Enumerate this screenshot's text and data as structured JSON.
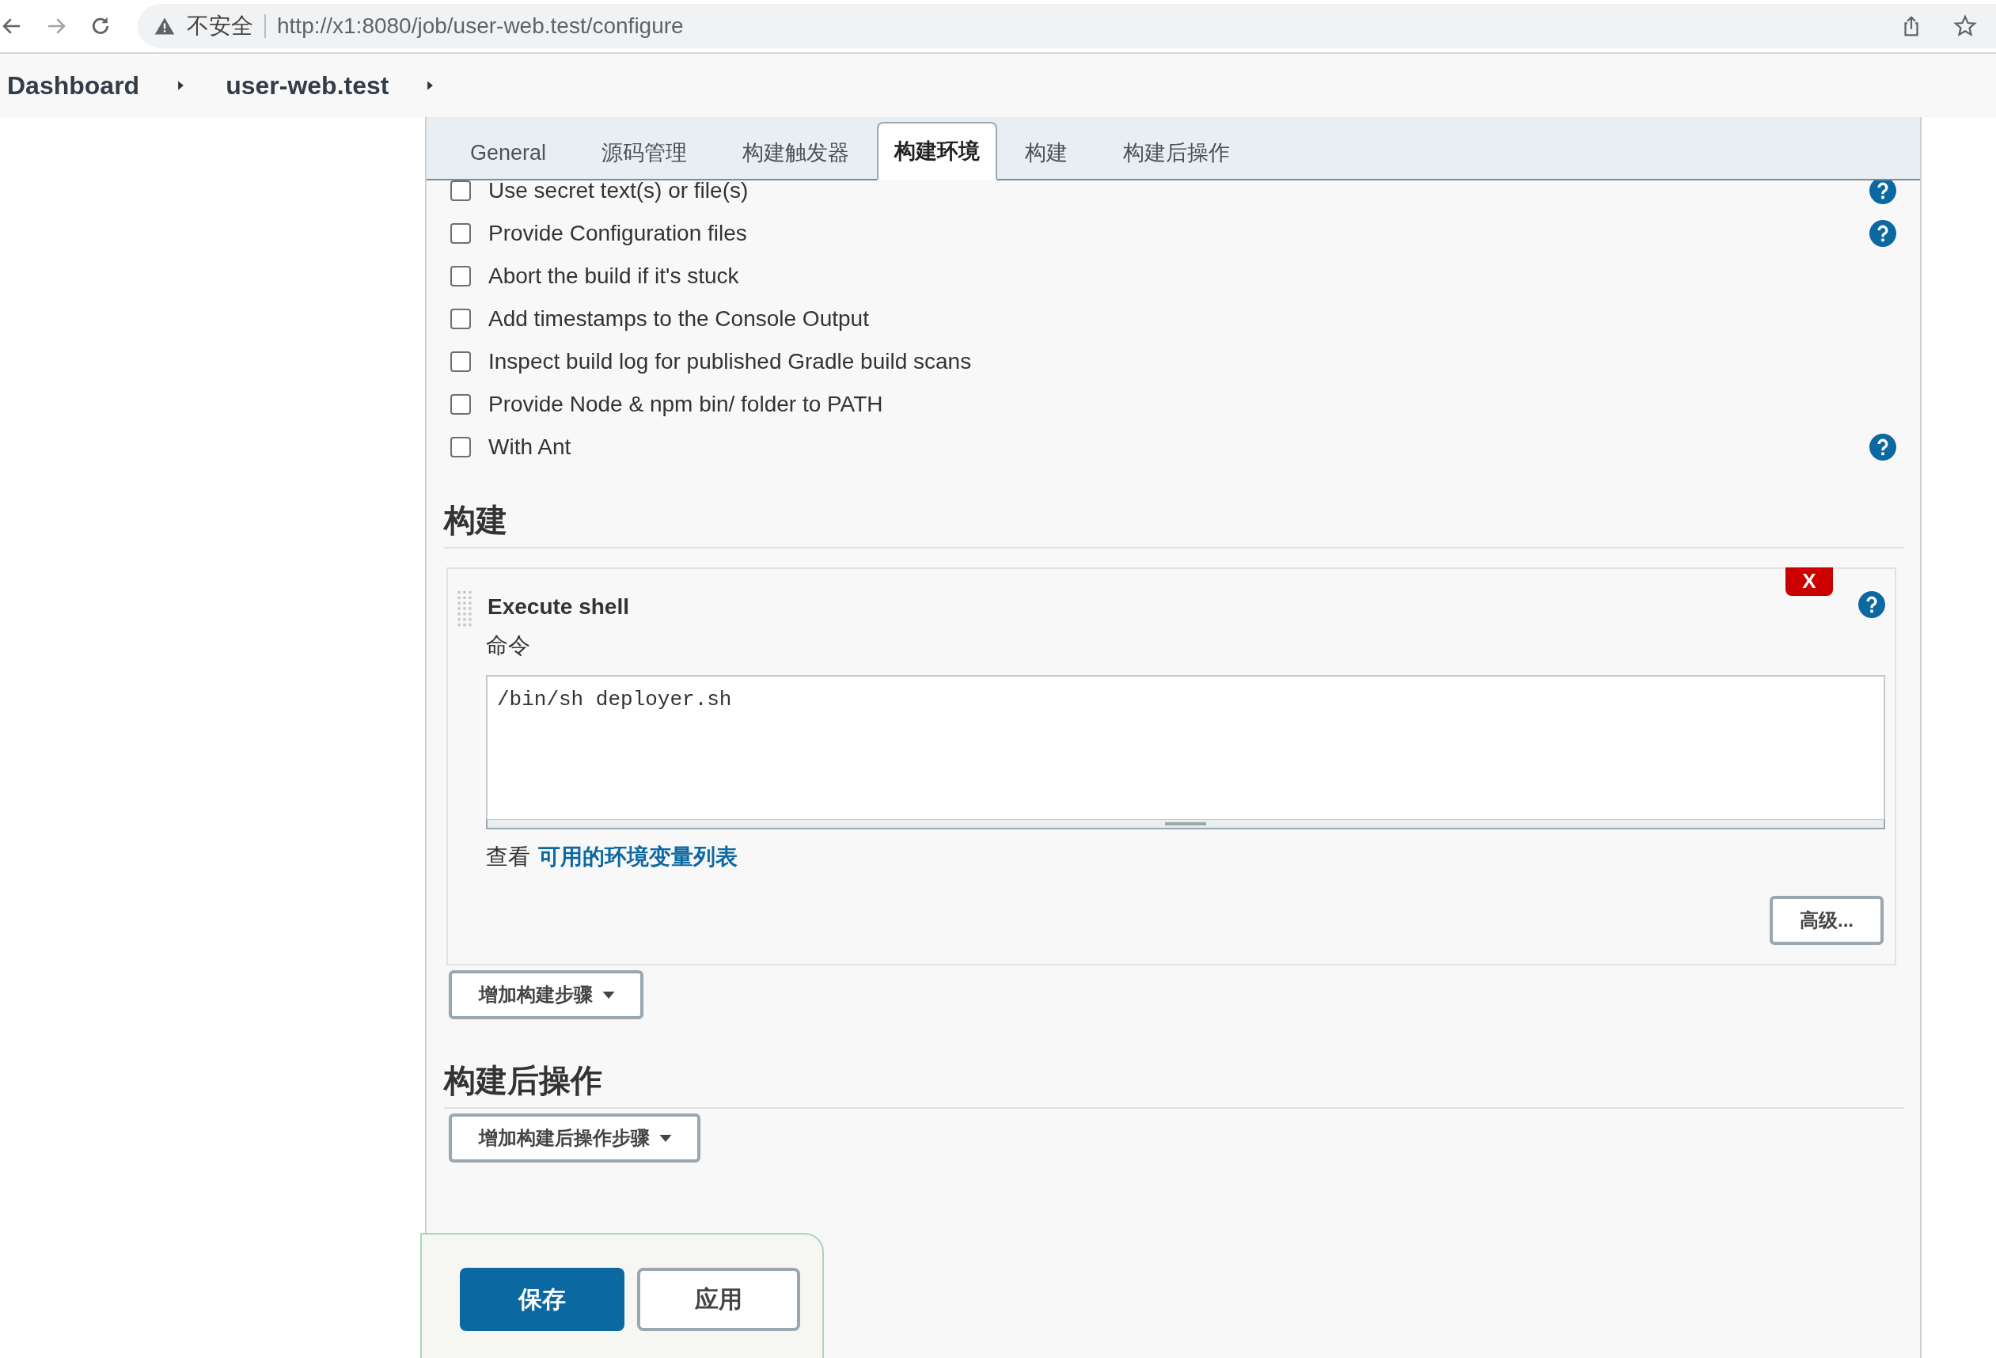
{
  "browser": {
    "security_label": "不安全",
    "url": "http://x1:8080/job/user-web.test/configure"
  },
  "breadcrumbs": [
    "Dashboard",
    "user-web.test"
  ],
  "tabs": [
    {
      "label": "General",
      "selected": false
    },
    {
      "label": "源码管理",
      "selected": false
    },
    {
      "label": "构建触发器",
      "selected": false
    },
    {
      "label": "构建环境",
      "selected": true
    },
    {
      "label": "构建",
      "selected": false
    },
    {
      "label": "构建后操作",
      "selected": false
    }
  ],
  "options": [
    {
      "label": "Use secret text(s) or file(s)",
      "checked": false,
      "help": true
    },
    {
      "label": "Provide Configuration files",
      "checked": false,
      "help": true
    },
    {
      "label": "Abort the build if it's stuck",
      "checked": false,
      "help": false
    },
    {
      "label": "Add timestamps to the Console Output",
      "checked": false,
      "help": false
    },
    {
      "label": "Inspect build log for published Gradle build scans",
      "checked": false,
      "help": false
    },
    {
      "label": "Provide Node & npm bin/ folder to PATH",
      "checked": false,
      "help": false
    },
    {
      "label": "With Ant",
      "checked": false,
      "help": true
    }
  ],
  "build_section": {
    "title": "构建",
    "steps": [
      {
        "title": "Execute shell",
        "delete_label": "X",
        "field_label": "命令",
        "value": "/bin/sh deployer.sh",
        "env_prefix": "查看",
        "env_link": "可用的环境变量列表",
        "advanced_button": "高级..."
      }
    ],
    "add_step_button": "增加构建步骤"
  },
  "post_build_section": {
    "title": "构建后操作",
    "add_step_button": "增加构建后操作步骤"
  },
  "buttons": {
    "save": "保存",
    "apply": "应用"
  }
}
